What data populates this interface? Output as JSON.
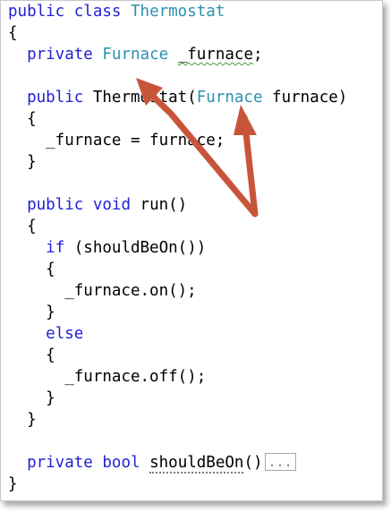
{
  "code": {
    "lines": [
      [
        {
          "t": "public",
          "k": "kw"
        },
        {
          "t": " "
        },
        {
          "t": "class",
          "k": "kw"
        },
        {
          "t": " "
        },
        {
          "t": "Thermostat",
          "k": "ty"
        }
      ],
      [
        {
          "t": "{"
        }
      ],
      [
        {
          "t": "  "
        },
        {
          "t": "private",
          "k": "kw"
        },
        {
          "t": " "
        },
        {
          "t": "Furnace",
          "k": "ty"
        },
        {
          "t": " "
        },
        {
          "t": "_furnace",
          "k": "squiggle"
        },
        {
          "t": ";"
        }
      ],
      [],
      [
        {
          "t": "  "
        },
        {
          "t": "public",
          "k": "kw"
        },
        {
          "t": " Thermostat("
        },
        {
          "t": "Furnace",
          "k": "ty"
        },
        {
          "t": " furnace)"
        }
      ],
      [
        {
          "t": "  {"
        }
      ],
      [
        {
          "t": "    _furnace = furnace;"
        }
      ],
      [
        {
          "t": "  }"
        }
      ],
      [],
      [
        {
          "t": "  "
        },
        {
          "t": "public",
          "k": "kw"
        },
        {
          "t": " "
        },
        {
          "t": "void",
          "k": "kw"
        },
        {
          "t": " run()"
        }
      ],
      [
        {
          "t": "  {"
        }
      ],
      [
        {
          "t": "    "
        },
        {
          "t": "if",
          "k": "kw"
        },
        {
          "t": " (shouldBeOn())"
        }
      ],
      [
        {
          "t": "    {"
        }
      ],
      [
        {
          "t": "      _furnace.on();"
        }
      ],
      [
        {
          "t": "    }"
        }
      ],
      [
        {
          "t": "    "
        },
        {
          "t": "else",
          "k": "kw"
        }
      ],
      [
        {
          "t": "    {"
        }
      ],
      [
        {
          "t": "      _furnace.off();"
        }
      ],
      [
        {
          "t": "    }"
        }
      ],
      [
        {
          "t": "  }"
        }
      ],
      [],
      [
        {
          "t": "  "
        },
        {
          "t": "private",
          "k": "kw"
        },
        {
          "t": " "
        },
        {
          "t": "bool",
          "k": "kw"
        },
        {
          "t": " "
        },
        {
          "t": "shouldBeOn",
          "k": "dotted"
        },
        {
          "t": "()"
        },
        {
          "t": "...",
          "k": "collapsed"
        }
      ],
      [
        {
          "t": "}"
        }
      ]
    ]
  },
  "colors": {
    "keyword": "#1f1fd6",
    "type": "#2b91af",
    "plain": "#000000",
    "arrow": "#c8553a",
    "squiggle": "#3aa33a"
  },
  "annotations": {
    "arrows": [
      {
        "name": "arrow-to-field-type",
        "target": "Furnace (field type)"
      },
      {
        "name": "arrow-to-parameter-type",
        "target": "Furnace (constructor parameter type)"
      }
    ]
  }
}
